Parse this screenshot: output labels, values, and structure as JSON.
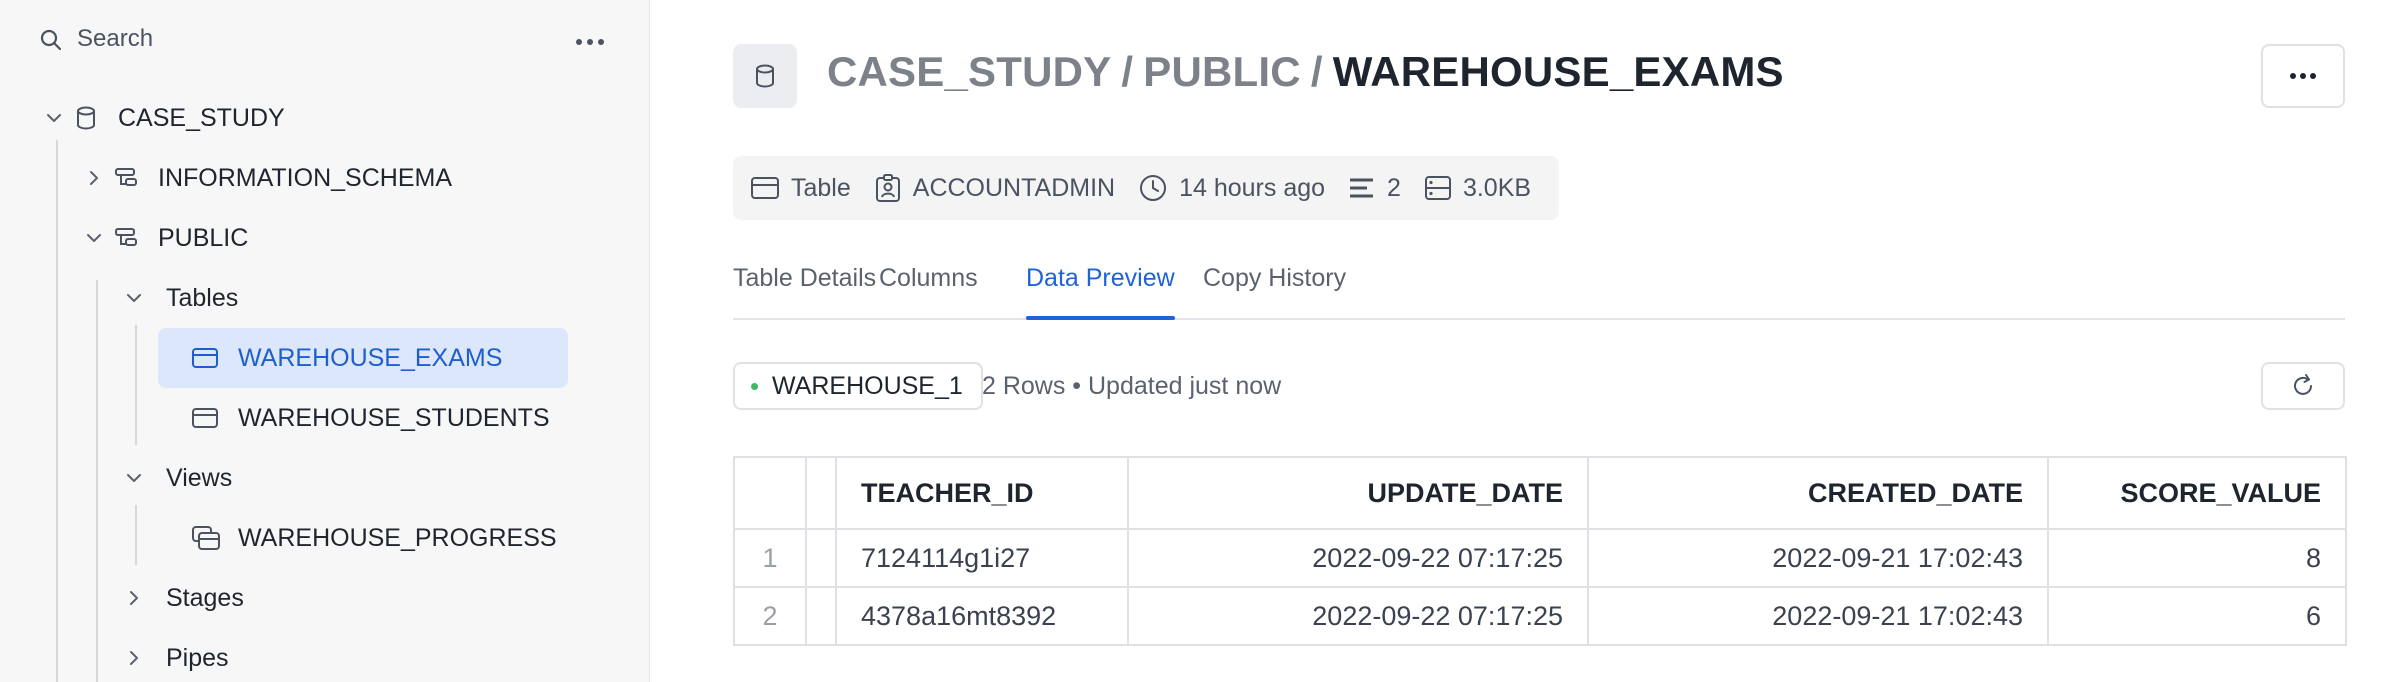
{
  "sidebar": {
    "search_label": "Search",
    "tree": {
      "database": "CASE_STUDY",
      "schemas": [
        "INFORMATION_SCHEMA",
        "PUBLIC"
      ],
      "groups": {
        "tables": "Tables",
        "views": "Views",
        "stages": "Stages",
        "pipes": "Pipes"
      },
      "tables": [
        "WAREHOUSE_EXAMS",
        "WAREHOUSE_STUDENTS"
      ],
      "views": [
        "WAREHOUSE_PROGRESS"
      ],
      "selected": "WAREHOUSE_EXAMS"
    }
  },
  "header": {
    "crumb_db": "CASE_STUDY",
    "crumb_sep": "/",
    "crumb_schema": "PUBLIC",
    "crumb_table": "WAREHOUSE_EXAMS"
  },
  "meta": {
    "type": "Table",
    "owner": "ACCOUNTADMIN",
    "modified": "14 hours ago",
    "rows": "2",
    "size": "3.0KB"
  },
  "tabs": [
    "Table Details",
    "Columns",
    "Data Preview",
    "Copy History"
  ],
  "active_tab": "Data Preview",
  "preview": {
    "warehouse": "WAREHOUSE_1",
    "status": "2 Rows • Updated just now",
    "columns": [
      "TEACHER_ID",
      "UPDATE_DATE",
      "CREATED_DATE",
      "SCORE_VALUE"
    ],
    "rows": [
      {
        "n": "1",
        "cells": [
          "7124114g1i27",
          "2022-09-22 07:17:25",
          "2022-09-21 17:02:43",
          "8"
        ]
      },
      {
        "n": "2",
        "cells": [
          "4378a16mt8392",
          "2022-09-22 07:17:25",
          "2022-09-21 17:02:43",
          "6"
        ]
      }
    ]
  },
  "colors": {
    "accent": "#1f63d6",
    "selected_bg": "#dde7fb",
    "status_dot": "#3fba63"
  },
  "icons": {
    "search": "search-icon",
    "more": "ellipsis-icon",
    "database": "database-icon",
    "schema": "schema-icon",
    "table": "table-icon",
    "view": "view-icon",
    "owner": "user-badge-icon",
    "clock": "clock-icon",
    "rows": "rows-icon",
    "size": "storage-icon",
    "refresh": "refresh-icon"
  }
}
